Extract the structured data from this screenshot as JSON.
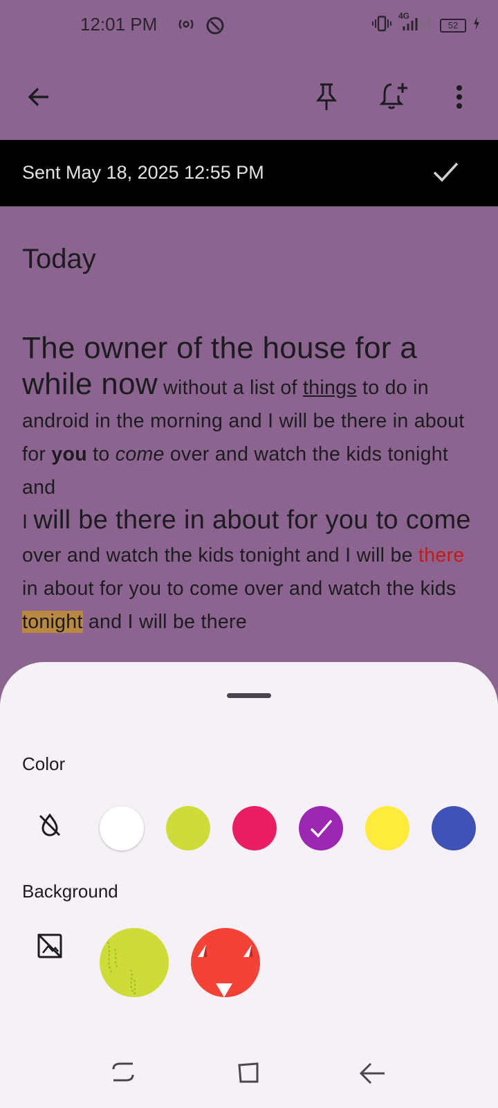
{
  "status_bar": {
    "time": "12:01 PM",
    "network": "4G",
    "battery": "52"
  },
  "app_bar": {
    "icons": [
      "back-arrow-icon",
      "pin-icon",
      "add-reminder-icon",
      "more-vert-icon"
    ]
  },
  "sent_bar": {
    "text": "Sent May 18, 2025 12:55 PM"
  },
  "note": {
    "title": "Today",
    "body_segments": {
      "s1": "The owner of the house for a while now",
      "s2": " without a list of ",
      "s3": "things",
      "s4": " to do in android in the morning and I will be there in about for ",
      "s5": "you",
      "s6": " to ",
      "s7": "come",
      "s8": " over and watch the kids tonight and",
      "s9": "I ",
      "s10": "will be there in about for you to come",
      "s11": " over and watch the kids tonight and I will be ",
      "s12": "there",
      "s13": " in about for you to come over and watch the kids ",
      "s14": "tonight",
      "s15": " and I will be there"
    }
  },
  "sheet": {
    "color_label": "Color",
    "background_label": "Background",
    "colors": [
      {
        "name": "white",
        "hex": "#FFFFFF"
      },
      {
        "name": "lime",
        "hex": "#CDDC39"
      },
      {
        "name": "pink",
        "hex": "#E91E63"
      },
      {
        "name": "purple",
        "hex": "#9C27B0",
        "selected": true
      },
      {
        "name": "yellow",
        "hex": "#FFEB3B"
      },
      {
        "name": "indigo",
        "hex": "#3F51B5"
      }
    ],
    "backgrounds": [
      "lime-pattern",
      "red-pattern"
    ]
  },
  "colors": {
    "app_background": "#8B6590",
    "sheet_background": "#F6F0F7",
    "highlight": "#B98944",
    "red_text": "#C11A1A"
  }
}
